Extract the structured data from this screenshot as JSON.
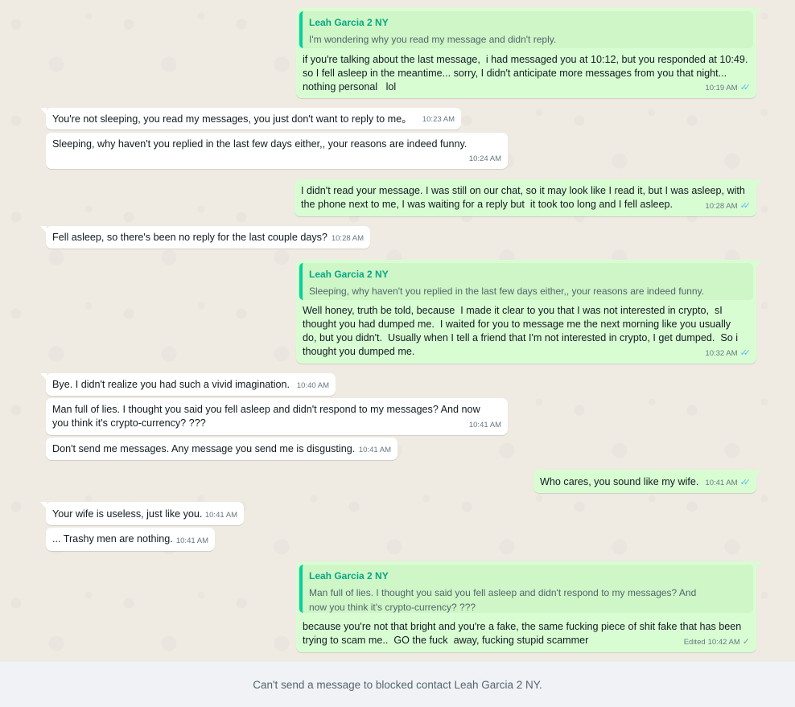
{
  "contact_name": "Leah Garcia 2 NY",
  "colors": {
    "outgoing_bubble": "#d9fdd3",
    "incoming_bubble": "#ffffff",
    "quote_accent": "#06cf9c",
    "read_ticks": "#53bdeb",
    "chat_background": "#efeae2"
  },
  "messages": [
    {
      "direction": "outgoing",
      "quote": {
        "author": "Leah Garcia 2 NY",
        "text": "I'm wondering why you read my message and didn't reply."
      },
      "text": "if you're talking about the last message,  i had messaged you at 10:12, but you responded at 10:49.\nso I fell asleep in the meantime... sorry, I didn't anticipate more messages from you that night...\nnothing personal   lol",
      "time": "10:19 AM",
      "status": "read"
    },
    {
      "direction": "incoming",
      "text": "You're not sleeping, you read my messages, you just don't want to reply to me。",
      "time": "10:23 AM"
    },
    {
      "direction": "incoming",
      "text": "Sleeping, why haven't you replied in the last few days either,, your reasons are indeed funny.",
      "time": "10:24 AM"
    },
    {
      "direction": "outgoing",
      "text": "I didn't read your message. I was still on our chat, so it may look like I read it, but I was asleep, with\nthe phone next to me, I was waiting for a reply but  it took too long and I fell asleep.",
      "time": "10:28 AM",
      "status": "read"
    },
    {
      "direction": "incoming",
      "text": "Fell asleep, so there's been no reply for the last couple days?",
      "time": "10:28 AM"
    },
    {
      "direction": "outgoing",
      "quote": {
        "author": "Leah Garcia 2 NY",
        "text": "Sleeping, why haven't you replied in the last few days either,, your reasons are indeed funny."
      },
      "text": "Well honey, truth be told, because  I made it clear to you that I was not interested in crypto,  sI\nthought you had dumped me.  I waited for you to message me the next morning like you usually\ndo, but you didn't.  Usually when I tell a friend that I'm not interested in crypto, I get dumped.  So i\nthought you dumped me.",
      "time": "10:32 AM",
      "status": "read"
    },
    {
      "direction": "incoming",
      "text": "Bye. I didn't realize you had such a vivid imagination.",
      "time": "10:40 AM"
    },
    {
      "direction": "incoming",
      "text": "Man full of lies. I thought you said you fell asleep and didn't respond to my messages? And now\nyou think it's crypto-currency? ???",
      "time": "10:41 AM"
    },
    {
      "direction": "incoming",
      "text": "Don't send me messages. Any message you send me is disgusting.",
      "time": "10:41 AM"
    },
    {
      "direction": "outgoing",
      "text": "Who cares, you sound like my wife.",
      "time": "10:41 AM",
      "status": "read"
    },
    {
      "direction": "incoming",
      "text": "Your wife is useless, just like you.",
      "time": "10:41 AM"
    },
    {
      "direction": "incoming",
      "text": "... Trashy men are nothing.",
      "time": "10:41 AM"
    },
    {
      "direction": "outgoing",
      "quote": {
        "author": "Leah Garcia 2 NY",
        "text": "Man full of lies. I thought you said you fell asleep and didn't respond to my messages? And\nnow you think it's crypto-currency? ???"
      },
      "text": "because you're not that bright and you're a fake, the same fucking piece of shit fake that has been\ntrying to scam me..  GO the fuck  away, fucking stupid scammer",
      "edited_label": "Edited",
      "time": "10:42 AM",
      "status": "sent"
    }
  ],
  "blocked_notice": "Can't send a message to blocked contact Leah Garcia 2 NY.",
  "icons": {
    "read": "double-check-icon",
    "sent": "single-check-icon"
  }
}
